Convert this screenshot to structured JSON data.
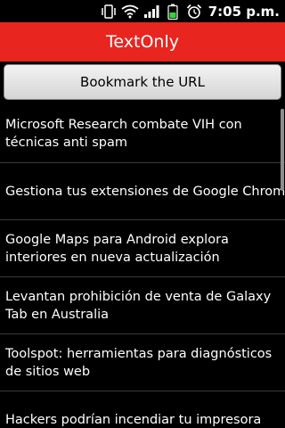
{
  "status_bar": {
    "time": "7:05 p.m.",
    "icons": [
      "vibrate-icon",
      "wifi-icon",
      "signal-icon",
      "battery-icon",
      "alarm-icon"
    ]
  },
  "app": {
    "title": "TextOnly",
    "accent_color": "#e8251f"
  },
  "bookmark_button": {
    "label": "Bookmark the URL"
  },
  "news": {
    "items": [
      {
        "title": "Microsoft Research combate VIH con técnicas anti spam"
      },
      {
        "title": "Gestiona tus extensiones de Google Chrome"
      },
      {
        "title": "Google Maps para Android explora interiores en nueva actualización"
      },
      {
        "title": "Levantan prohibición de venta de Galaxy Tab en Australia"
      },
      {
        "title": "Toolspot: herramientas para diagnósticos de sitios web"
      },
      {
        "title": "Hackers podrían incendiar tu impresora"
      }
    ]
  }
}
